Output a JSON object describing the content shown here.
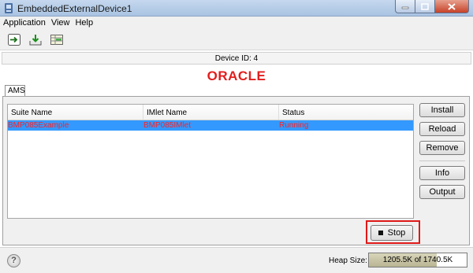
{
  "window": {
    "title": "EmbeddedExternalDevice1"
  },
  "menu": {
    "items": [
      "Application",
      "View",
      "Help"
    ]
  },
  "toolbar": {
    "icons": [
      "arrow-right-icon",
      "download-icon",
      "grid-icon"
    ]
  },
  "device": {
    "id_label": "Device ID: 4"
  },
  "brand": {
    "logo_text": "ORACLE",
    "color": "#e21d1d"
  },
  "tabs": {
    "active": "AMS"
  },
  "table": {
    "columns": [
      "Suite Name",
      "IMlet Name",
      "Status"
    ],
    "rows": [
      {
        "suite": "BMP085Example",
        "imlet": "BMP085IMlet",
        "status": "Running"
      }
    ],
    "selection_color": "#3399ff",
    "text_color": "#ff2222"
  },
  "actions": {
    "install": "Install",
    "reload": "Reload",
    "remove": "Remove",
    "info": "Info",
    "output": "Output",
    "stop": "Stop"
  },
  "status": {
    "help_symbol": "?",
    "heap_label": "Heap Size:",
    "heap_text": "1205.5K of 1740.5K",
    "heap_fraction": 0.69
  }
}
